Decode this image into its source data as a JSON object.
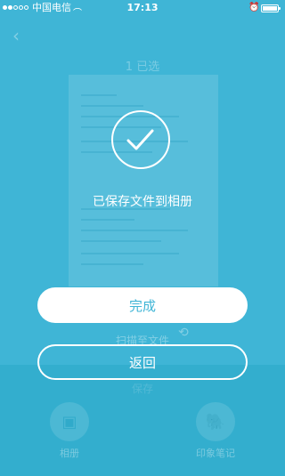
{
  "status_bar": {
    "carrier": "中国电信",
    "wifi_icon": "wifi-icon",
    "time": "17:13",
    "alarm_icon": "alarm-icon",
    "battery_icon": "battery-icon"
  },
  "background": {
    "back_icon": "chevron-left-icon",
    "page_indicator": "1 已选",
    "rotate_icon": "rotate-icon",
    "mid_label": "扫描至文件",
    "lower_label": "保存",
    "actions": [
      {
        "label": "相册",
        "icon": "gallery-icon"
      },
      {
        "label": "印象笔记",
        "icon": "evernote-icon"
      }
    ]
  },
  "overlay": {
    "success_icon": "checkmark-icon",
    "message": "已保存文件到相册",
    "done_label": "完成",
    "back_label": "返回"
  },
  "colors": {
    "overlay_background": "#3fb5d6",
    "button_text": "#3fb5d6",
    "foreground": "#ffffff"
  }
}
